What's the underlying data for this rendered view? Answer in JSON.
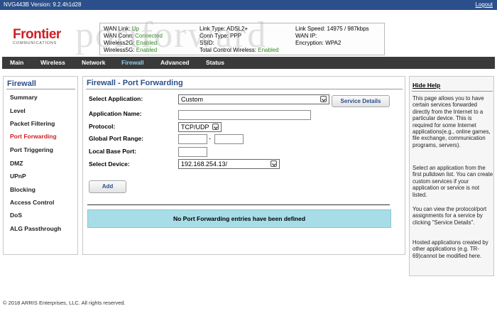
{
  "topbar": {
    "version": "NVG443B Version: 9.2.4h1d28",
    "logout": "Logout"
  },
  "logo": {
    "brand": "Frontier",
    "sub": "COMMUNICATIONS"
  },
  "watermark": "portforward",
  "status": {
    "col1": [
      {
        "label": "WAN Link:",
        "value": "Up"
      },
      {
        "label": "WAN Conn:",
        "value": "Connected"
      },
      {
        "label": "Wireless2G:",
        "value": "Enabled"
      },
      {
        "label": "Wireless5G:",
        "value": "Enabled"
      }
    ],
    "col2": [
      {
        "label": "Link Type:",
        "value": "ADSL2+"
      },
      {
        "label": "Conn Type:",
        "value": "PPP"
      },
      {
        "label": "SSID:",
        "value": ""
      },
      {
        "label": "Total Control Wireless:",
        "value": "Enabled"
      }
    ],
    "col3": [
      {
        "label": "Link Speed:",
        "value": "14975 / 987kbps"
      },
      {
        "label": "WAN IP:",
        "value": ""
      },
      {
        "label": "Encryption:",
        "value": "WPA2"
      }
    ]
  },
  "nav": [
    "Main",
    "Wireless",
    "Network",
    "Firewall",
    "Advanced",
    "Status"
  ],
  "sidebar": {
    "title": "Firewall",
    "items": [
      "Summary",
      "Level",
      "Packet Filtering",
      "Port Forwarding",
      "Port Triggering",
      "DMZ",
      "UPnP",
      "Blocking",
      "Access Control",
      "DoS",
      "ALG Passthrough"
    ]
  },
  "main": {
    "title": "Firewall - Port Forwarding",
    "labels": {
      "application": "Select Application:",
      "app_name": "Application Name:",
      "protocol": "Protocol:",
      "global_range": "Global Port Range:",
      "local_base": "Local Base Port:",
      "device": "Select Device:"
    },
    "application_value": "Custom",
    "protocol_value": "TCP/UDP",
    "range_separator": "-",
    "device_value": "192.168.254.13/",
    "service_details": "Service Details",
    "add": "Add",
    "empty_message": "No Port Forwarding entries have been defined"
  },
  "help": {
    "title": "Hide Help",
    "paragraphs": [
      "This page allows you to have certain services forwarded directly from the Internet to a particular device. This is required for some Internet applications(e.g., online games, file exchange, communication programs, servers).",
      "Select an application from the first pulldown list. You can create custom services if your application or service is not listed.",
      "You can view the protocol/port assignments for a service by clicking \"Service Details\".",
      "Hosted applications created by other applications (e.g. TR-69)cannot be modified here."
    ]
  },
  "footer": "© 2018 ARRIS Enterprises, LLC. All rights reserved."
}
